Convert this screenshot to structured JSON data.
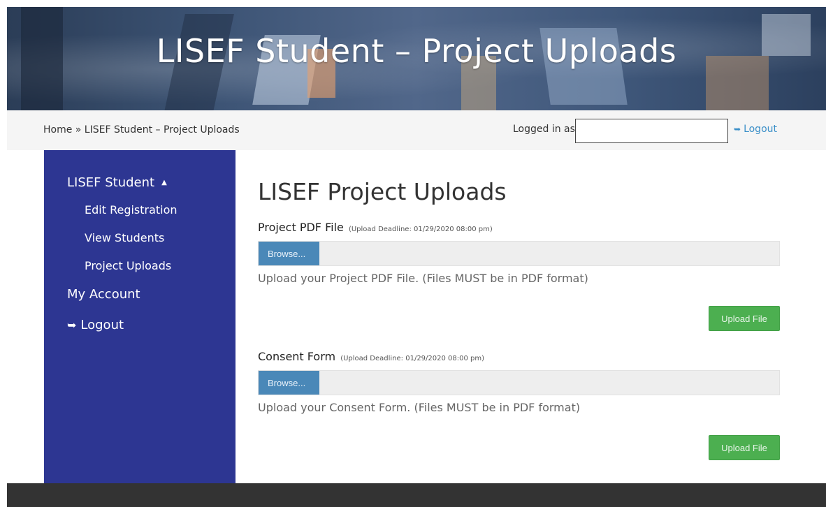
{
  "header": {
    "title": "LISEF Student – Project Uploads"
  },
  "breadcrumb": {
    "text": "Home » LISEF Student – Project Uploads"
  },
  "login": {
    "label": "Logged in as:",
    "value": "",
    "logout_label": "Logout",
    "logout_icon": "sign-out-icon"
  },
  "sidebar": {
    "items": [
      {
        "label": "LISEF Student",
        "level": 1,
        "expanded": true,
        "icon": "caret-up-icon"
      },
      {
        "label": "Edit Registration",
        "level": 2
      },
      {
        "label": "View Students",
        "level": 2
      },
      {
        "label": "Project Uploads",
        "level": 2
      },
      {
        "label": "My Account",
        "level": 1
      },
      {
        "label": "Logout",
        "level": 1,
        "icon": "sign-out-icon"
      }
    ]
  },
  "main": {
    "title": "LISEF Project Uploads",
    "uploads": [
      {
        "label": "Project PDF File",
        "deadline": "(Upload Deadline: 01/29/2020 08:00 pm)",
        "browse_label": "Browse...",
        "help": "Upload your Project PDF File. (Files MUST be in PDF format)",
        "upload_label": "Upload File"
      },
      {
        "label": "Consent Form",
        "deadline": "(Upload Deadline: 01/29/2020 08:00 pm)",
        "browse_label": "Browse...",
        "help": "Upload your Consent Form. (Files MUST be in PDF format)",
        "upload_label": "Upload File"
      }
    ]
  },
  "colors": {
    "sidebar_bg": "#2d3692",
    "browse_bg": "#4a88b8",
    "upload_bg": "#4caf50",
    "link": "#3a8fc8",
    "footer_bg": "#333333"
  }
}
